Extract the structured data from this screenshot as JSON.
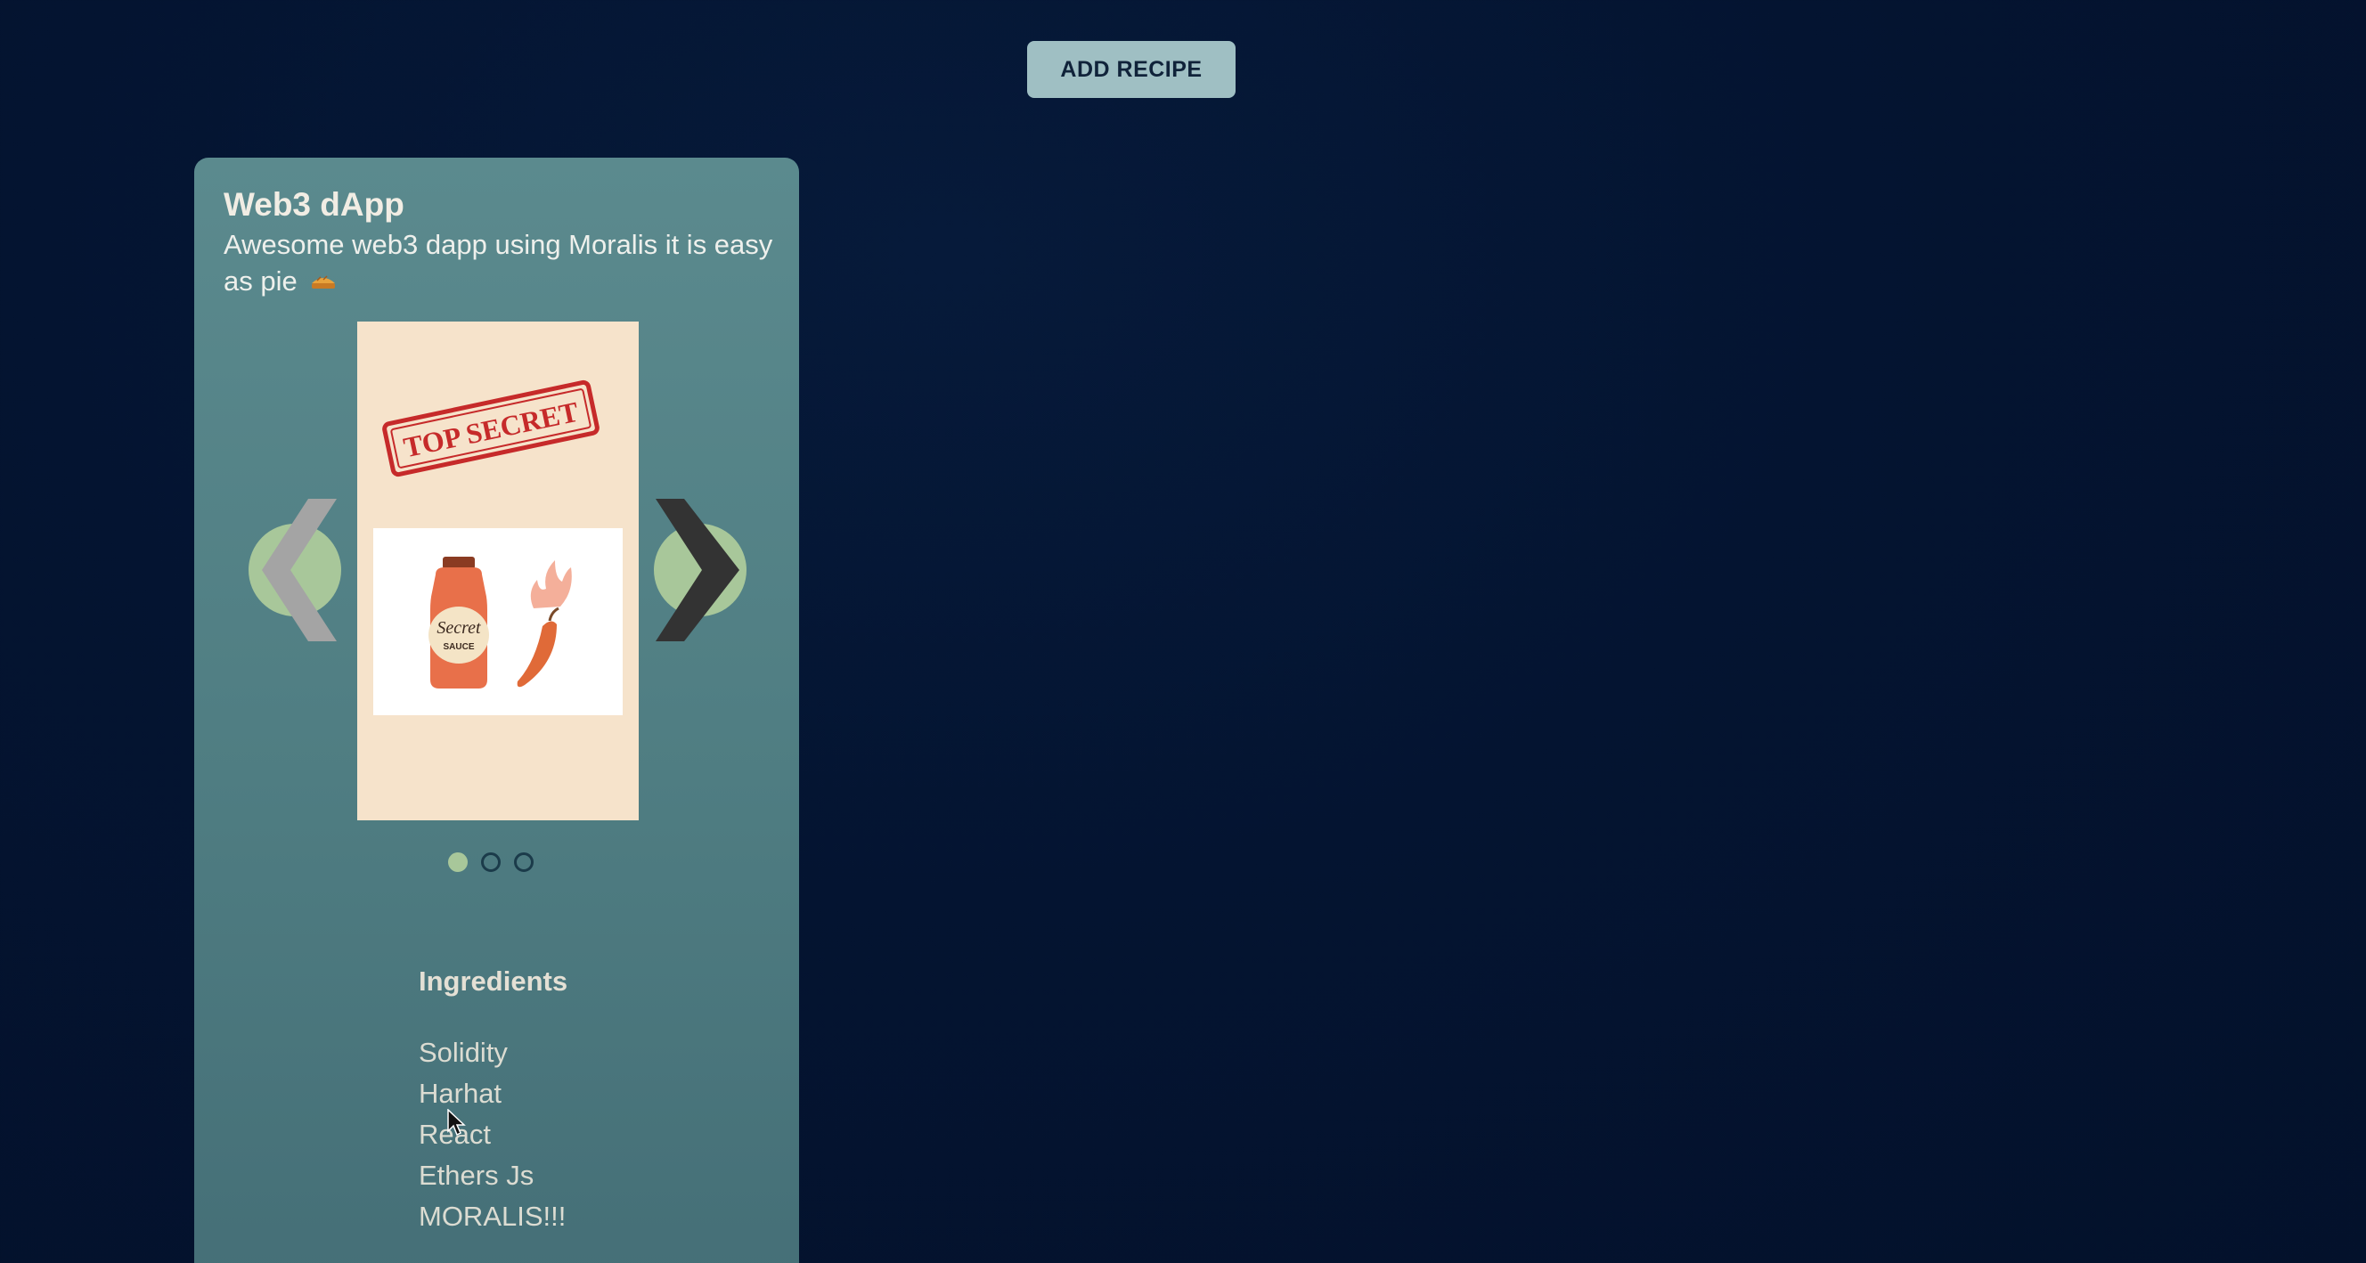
{
  "header": {
    "add_recipe_label": "ADD RECIPE"
  },
  "recipe": {
    "title": "Web3 dApp",
    "description": "Awesome web3 dapp using Moralis it is easy as pie",
    "description_icon": "pie-icon",
    "carousel": {
      "active_index": 0,
      "slide_count": 3,
      "image": {
        "stamp_text": "TOP SECRET",
        "jar_label_line1": "Secret",
        "jar_label_line2": "SAUCE"
      },
      "prev_icon": "chevron-left-icon",
      "next_icon": "chevron-right-icon"
    },
    "ingredients_heading": "Ingredients",
    "ingredients": [
      "Solidity",
      "Harhat",
      "React",
      "Ethers Js",
      "MORALIS!!!"
    ]
  },
  "colors": {
    "background": "#041431",
    "card": "#568589",
    "button": "#9fbfc3",
    "dot_active": "#a8c79a",
    "arrow_circle": "#a8c79a"
  }
}
